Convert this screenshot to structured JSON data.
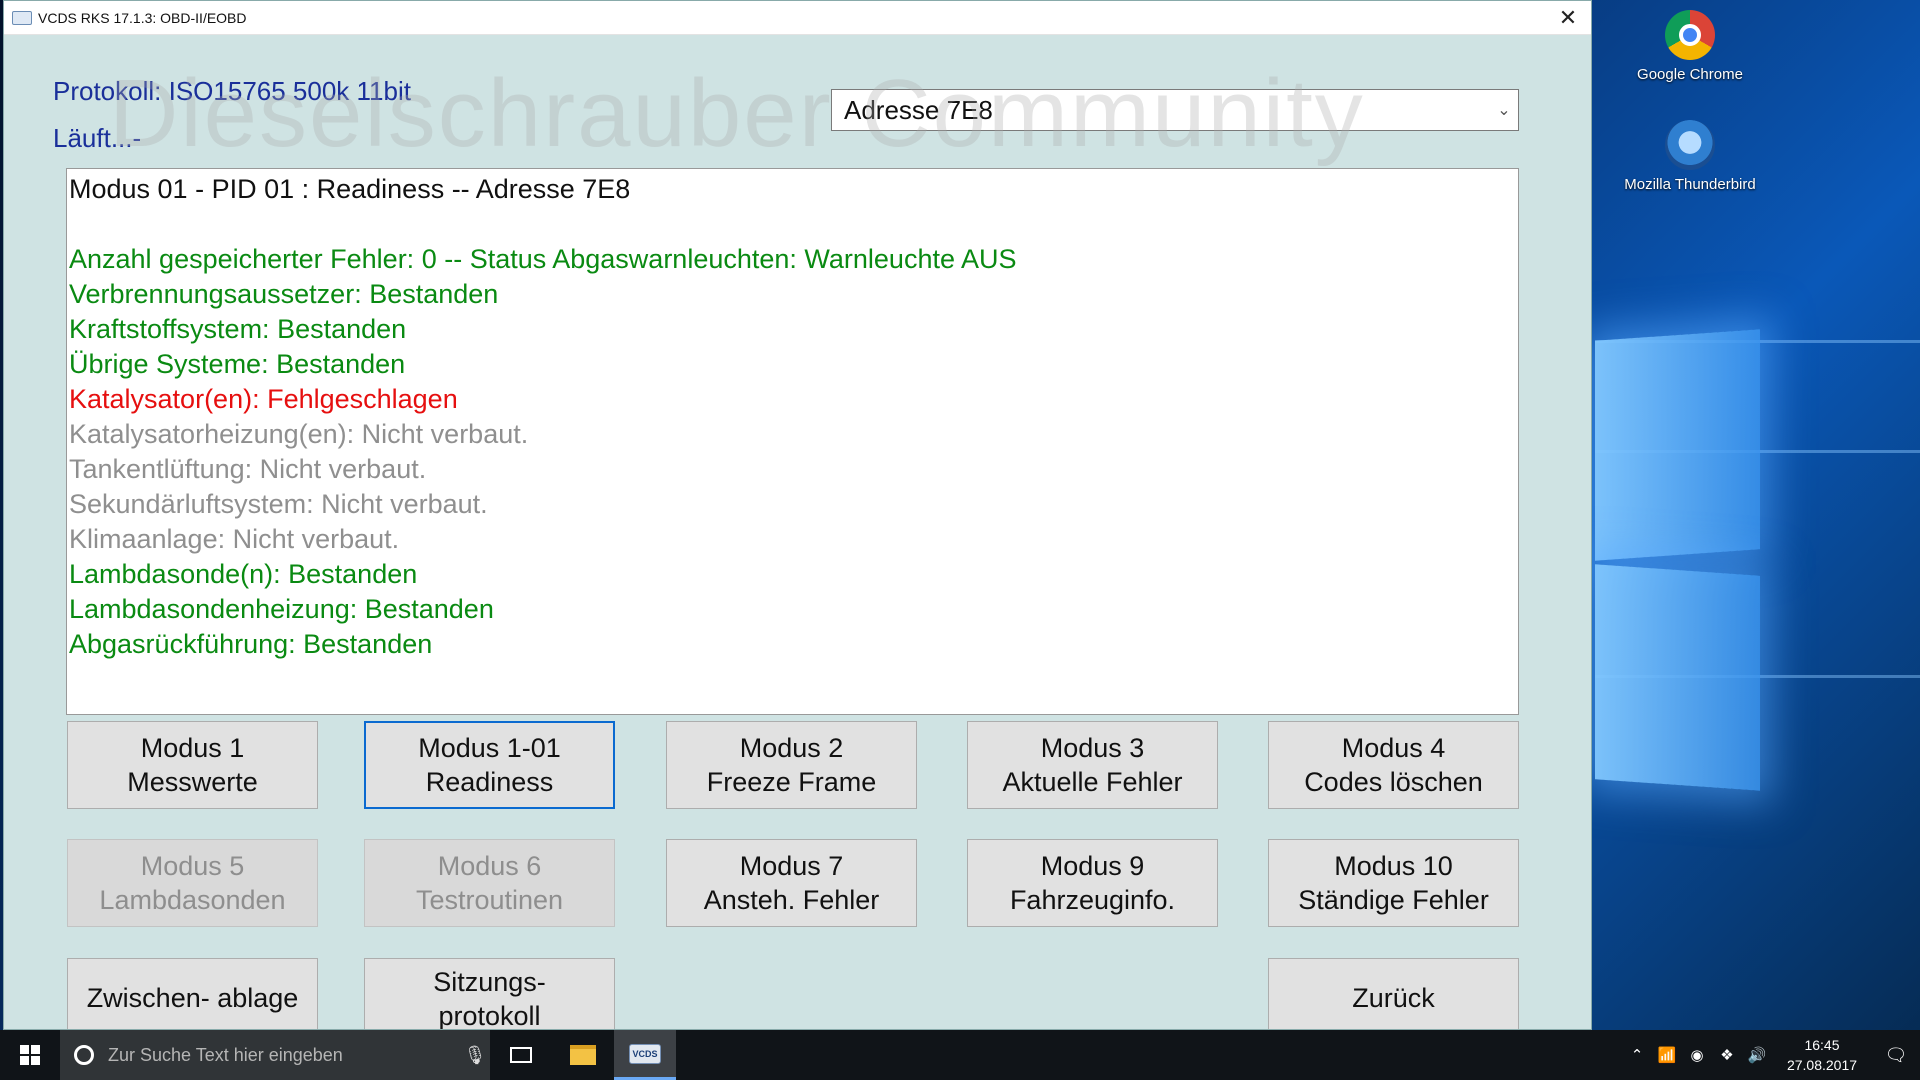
{
  "window": {
    "title": "VCDS RKS 17.1.3:  OBD-II/EOBD",
    "close_glyph": "✕"
  },
  "watermark": "Dieselschrauber Community",
  "header": {
    "protocol": "Protokoll: ISO15765 500k 11bit",
    "running": "Läuft...-"
  },
  "address_select": {
    "value": "Adresse 7E8",
    "chevron": "⌄"
  },
  "result": {
    "heading": "Modus 01 - PID 01 : Readiness  --  Adresse 7E8",
    "lines": [
      {
        "text": "Anzahl gespeicherter Fehler: 0  --  Status Abgaswarnleuchten: Warnleuchte AUS",
        "status": "ok"
      },
      {
        "text": "Verbrennungsaussetzer:  Bestanden",
        "status": "ok"
      },
      {
        "text": "Kraftstoffsystem:  Bestanden",
        "status": "ok"
      },
      {
        "text": "Übrige Systeme:  Bestanden",
        "status": "ok"
      },
      {
        "text": "Katalysator(en):  Fehlgeschlagen",
        "status": "fail"
      },
      {
        "text": "Katalysatorheizung(en): Nicht verbaut.",
        "status": "na"
      },
      {
        "text": "Tankentlüftung: Nicht verbaut.",
        "status": "na"
      },
      {
        "text": "Sekundärluftsystem: Nicht verbaut.",
        "status": "na"
      },
      {
        "text": "Klimaanlage: Nicht verbaut.",
        "status": "na"
      },
      {
        "text": "Lambdasonde(n):  Bestanden",
        "status": "ok"
      },
      {
        "text": "Lambdasondenheizung:  Bestanden",
        "status": "ok"
      },
      {
        "text": "Abgasrückführung:  Bestanden",
        "status": "ok"
      }
    ],
    "colors": {
      "ok": "#0a8a12",
      "fail": "#e60f0f",
      "na": "#8f8f8f"
    }
  },
  "buttons": {
    "mode1": {
      "line1": "Modus 1",
      "line2": "Messwerte"
    },
    "mode1_01": {
      "line1": "Modus 1-01",
      "line2": "Readiness"
    },
    "mode2": {
      "line1": "Modus 2",
      "line2": "Freeze Frame"
    },
    "mode3": {
      "line1": "Modus 3",
      "line2": "Aktuelle Fehler"
    },
    "mode4": {
      "line1": "Modus 4",
      "line2": "Codes löschen"
    },
    "mode5": {
      "line1": "Modus 5",
      "line2": "Lambdasonden"
    },
    "mode6": {
      "line1": "Modus 6",
      "line2": "Testroutinen"
    },
    "mode7": {
      "line1": "Modus 7",
      "line2": "Ansteh. Fehler"
    },
    "mode9": {
      "line1": "Modus 9",
      "line2": "Fahrzeuginfo."
    },
    "mode10": {
      "line1": "Modus 10",
      "line2": "Ständige Fehler"
    },
    "clipboard": {
      "line1": "Zwischen- ablage"
    },
    "session_log": {
      "line1": "Sitzungs-",
      "line2": "protokoll"
    },
    "back": {
      "line1": "Zurück"
    }
  },
  "desktop": {
    "icons": [
      {
        "label": "Google Chrome"
      },
      {
        "label": "Mozilla Thunderbird"
      }
    ]
  },
  "taskbar": {
    "search_placeholder": "Zur Suche Text hier eingeben",
    "time": "16:45",
    "date": "27.08.2017"
  }
}
